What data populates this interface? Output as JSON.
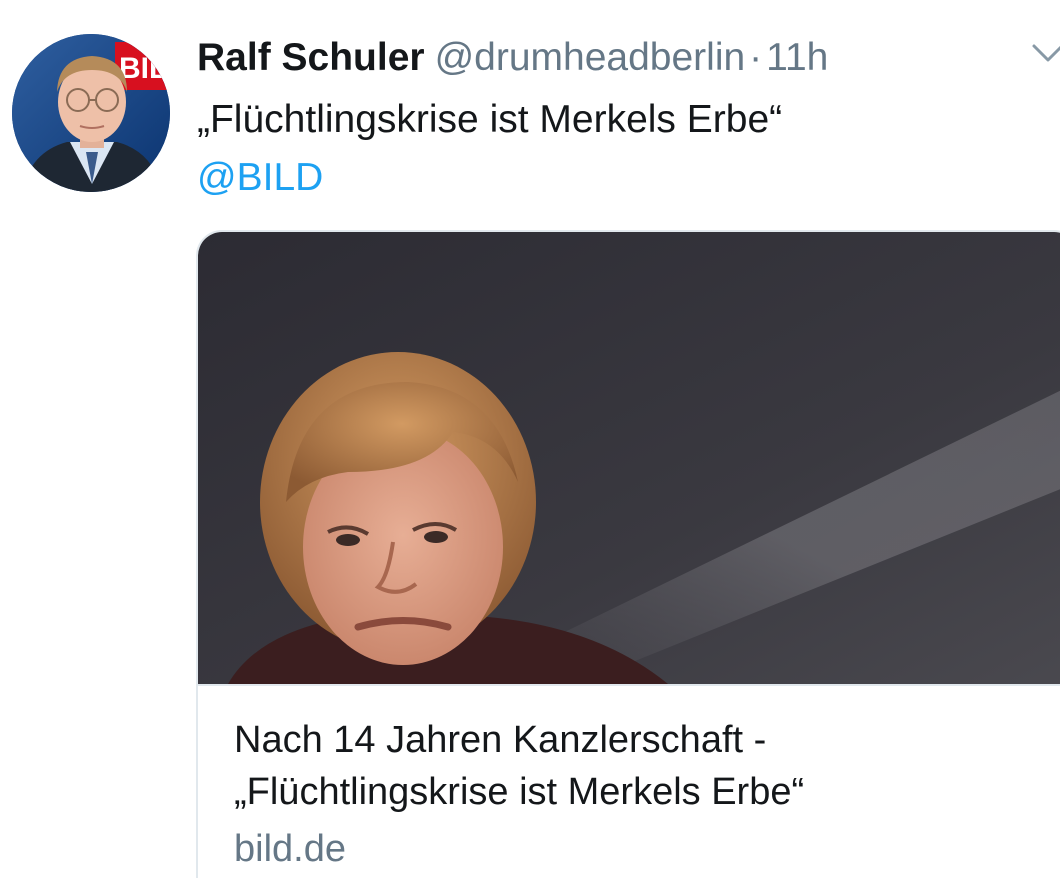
{
  "tweet": {
    "author_name": "Ralf Schuler",
    "author_handle": "@drumheadberlin",
    "separator": "·",
    "time": "11h",
    "text": "„Flüchtlingskrise ist Merkels Erbe“",
    "mention": "@BILD",
    "avatar_badge": "BILD"
  },
  "card": {
    "title_line1": "Nach 14 Jahren Kanzlerschaft -",
    "title_line2": "„Flüchtlingskrise ist Merkels Erbe“",
    "domain": "bild.de"
  },
  "icons": {
    "caret": "chevron-down-icon"
  },
  "colors": {
    "text": "#14171a",
    "secondary": "#657786",
    "link": "#1da1f2",
    "border": "#e1e8ed",
    "bild_red": "#d7101f"
  }
}
